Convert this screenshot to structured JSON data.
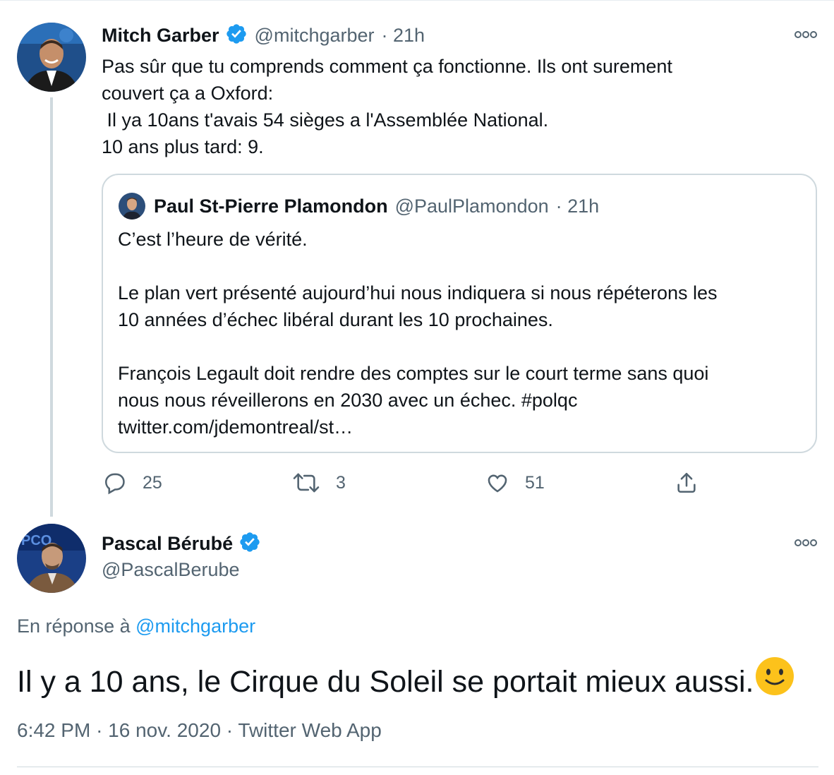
{
  "tweet1": {
    "author": {
      "name": "Mitch Garber",
      "handle": "@mitchgarber",
      "time": "· 21h"
    },
    "text": "Pas sûr que tu comprends comment ça fonctionne. Ils ont surement\ncouvert ça a Oxford:\n Il ya 10ans t'avais 54 sièges a l'Assemblée National.\n10 ans plus tard: 9.",
    "quote": {
      "author": {
        "name": "Paul St-Pierre Plamondon",
        "handle": "@PaulPlamondon",
        "time": "· 21h"
      },
      "text": "C’est l’heure de vérité.\n\nLe plan vert présenté aujourd’hui nous indiquera si nous répéterons les\n10 années d’échec libéral durant les 10 prochaines.\n\nFrançois Legault doit rendre des comptes sur le court terme sans quoi\nnous nous réveillerons en 2030 avec un échec. #polqc\ntwitter.com/jdemontreal/st…"
    },
    "actions": {
      "replies": "25",
      "retweets": "3",
      "likes": "51"
    }
  },
  "tweet2": {
    "author": {
      "name": "Pascal Bérubé",
      "handle": "@PascalBerube"
    },
    "reply_prefix": "En réponse à",
    "reply_mention": "@mitchgarber",
    "text": "Il y a 10 ans, le Cirque du Soleil se portait mieux aussi.",
    "emoji": "slightly-smiling-face-icon",
    "time": "6:42 PM",
    "date": "16 nov. 2020",
    "source": "Twitter Web App"
  },
  "colors": {
    "accent": "#1d9bf0",
    "secondary_text": "#536471",
    "border": "#cfd9de"
  }
}
